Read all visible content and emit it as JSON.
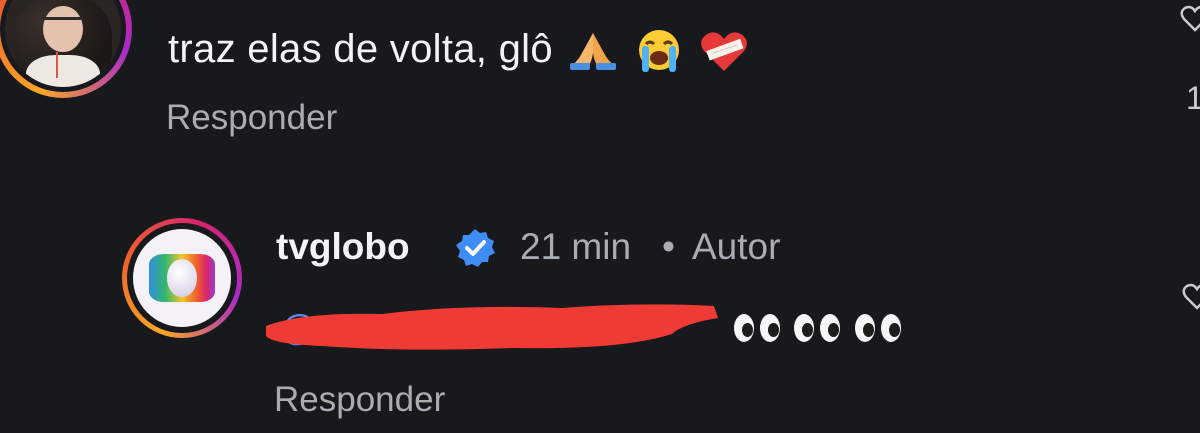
{
  "comments": [
    {
      "text": "traz elas de volta, glô",
      "emojis": [
        "folded-hands",
        "loudly-crying-face",
        "mending-heart"
      ],
      "reply_label": "Responder",
      "like_count_partial": "1"
    },
    {
      "username": "tvglobo",
      "verified": true,
      "time": "21 min",
      "separator": "•",
      "author_tag": "Autor",
      "mention": "@",
      "mention_redacted": true,
      "emojis": [
        "eyes",
        "eyes",
        "eyes"
      ],
      "reply_label": "Responder"
    }
  ],
  "colors": {
    "background": "#17191c",
    "text_primary": "#f3f4f6",
    "text_secondary": "#a8adb5",
    "mention": "#5b8def",
    "verified": "#3d8df5",
    "redaction": "#f03a35",
    "ring_gradient": [
      "#f9a825",
      "#f0612b",
      "#d6246f",
      "#a62cc6"
    ]
  }
}
